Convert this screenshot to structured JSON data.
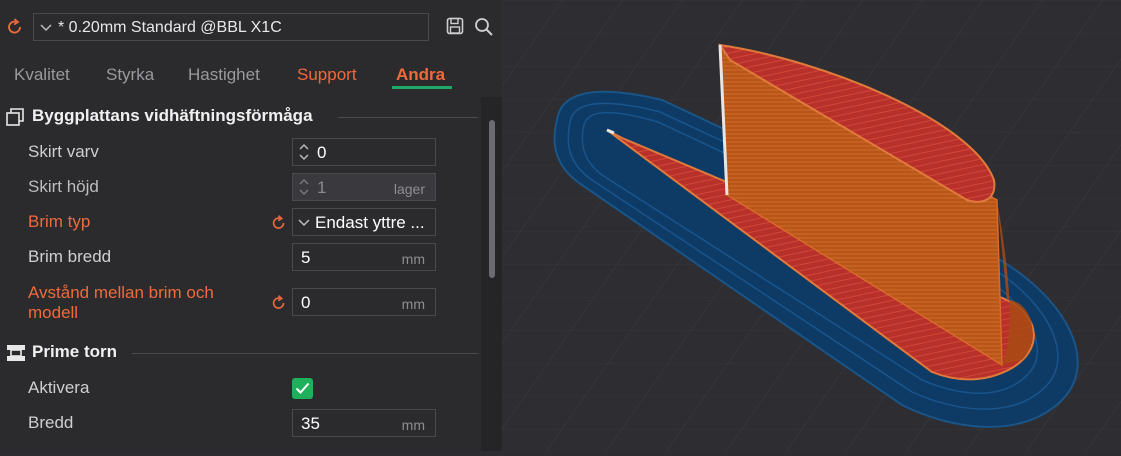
{
  "header": {
    "preset_name": "* 0.20mm Standard @BBL X1C"
  },
  "tabs": [
    {
      "label": "Kvalitet",
      "state": "normal"
    },
    {
      "label": "Styrka",
      "state": "normal"
    },
    {
      "label": "Hastighet",
      "state": "normal"
    },
    {
      "label": "Support",
      "state": "modified"
    },
    {
      "label": "Andra",
      "state": "active"
    }
  ],
  "sections": [
    {
      "title": "Byggplattans vidhäftningsförmåga",
      "rows": [
        {
          "label": "Skirt varv",
          "value": "0",
          "unit": ""
        },
        {
          "label": "Skirt höjd",
          "value": "1",
          "unit": "lager"
        },
        {
          "label": "Brim typ",
          "value": "Endast yttre ..."
        },
        {
          "label": "Brim bredd",
          "value": "5",
          "unit": "mm"
        },
        {
          "label": "Avstånd mellan brim och modell",
          "label_line1": "Avstånd mellan brim och",
          "label_line2": "modell",
          "value": "0",
          "unit": "mm"
        }
      ]
    },
    {
      "title": "Prime torn",
      "rows": [
        {
          "label": "Aktivera",
          "checked": true
        },
        {
          "label": "Bredd",
          "value": "35",
          "unit": "mm"
        }
      ]
    }
  ],
  "colors": {
    "accent": "#1fa86a",
    "modified": "#ef6a3b",
    "panel_bg": "#2b2b2e",
    "viewport_bg": "#2d2d32",
    "model_wall": "#c05a1c",
    "model_infill": "#b8302a",
    "brim": "#0e3a66"
  }
}
